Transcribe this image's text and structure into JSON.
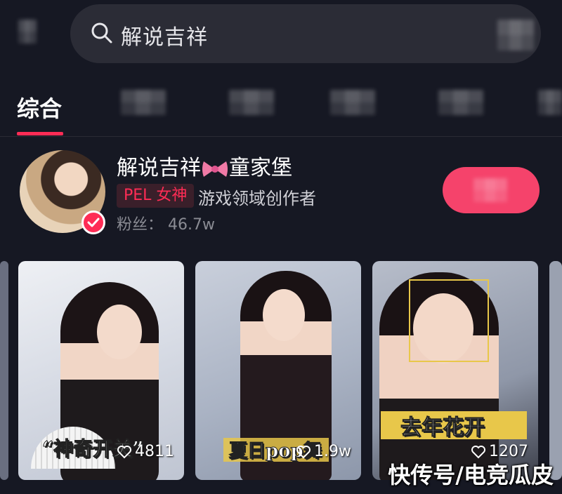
{
  "search": {
    "query": "解说吉祥"
  },
  "tabs": {
    "active": "综合"
  },
  "user": {
    "name_part1": "解说吉祥",
    "name_part2": "童家堡",
    "tag": "PEL 女神",
    "description": "游戏领域创作者",
    "fans": "粉丝：  46.7w"
  },
  "videos": [
    {
      "caption": "“神奇开关”",
      "likes": "4811"
    },
    {
      "caption": "夏日pop舞",
      "likes": "1.9w"
    },
    {
      "caption": "去年花开",
      "likes": "1207"
    }
  ],
  "watermark": "快传号/电竞瓜皮",
  "colors": {
    "accent": "#fe2c55",
    "background": "#161823"
  }
}
